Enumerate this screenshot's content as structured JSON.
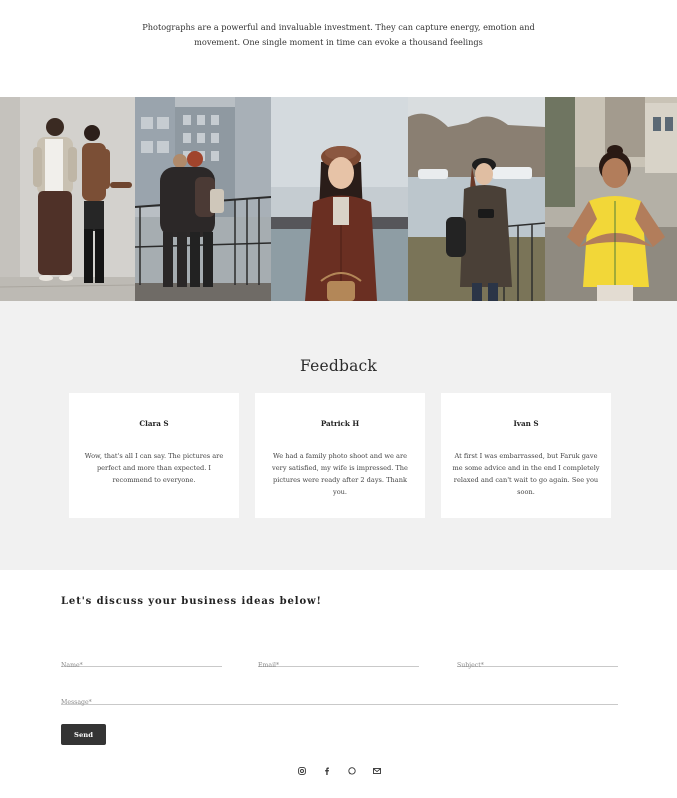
{
  "intro": {
    "line1": "Photographs are a powerful and invaluable investment. They can capture energy, emotion and",
    "line2": "movement. One single moment in time can evoke a thousand feelings"
  },
  "gallery": {
    "photos": [
      {
        "subject": "couple-standing"
      },
      {
        "subject": "couple-embracing"
      },
      {
        "subject": "woman-in-beret"
      },
      {
        "subject": "woman-with-phone"
      },
      {
        "subject": "girl-heart-hands"
      }
    ]
  },
  "feedback": {
    "title": "Feedback",
    "cards": [
      {
        "name": "Clara S",
        "text": "Wow, that's all I can say. The pictures are perfect and more than expected. I recommend to everyone."
      },
      {
        "name": "Patrick H",
        "text": "We had a family photo shoot and we are very satisfied, my wife is impressed. The pictures were ready after 2 days. Thank you."
      },
      {
        "name": "Ivan S",
        "text": "At first I was embarrassed, but Faruk gave me some advice and in the end I completely relaxed and can't wait to go again. See you soon."
      }
    ]
  },
  "contact": {
    "title": "Let's discuss your business ideas below!",
    "name_placeholder": "Name*",
    "email_placeholder": "Email*",
    "subject_placeholder": "Subject*",
    "message_placeholder": "Message*",
    "send_label": "Send"
  },
  "socials": {
    "icons": [
      "instagram-icon",
      "facebook-icon",
      "whatsapp-icon",
      "email-icon"
    ]
  },
  "colors": {
    "feedback_bg": "#f1f1f1",
    "button_bg": "#343434",
    "text": "#2a2a2a"
  }
}
